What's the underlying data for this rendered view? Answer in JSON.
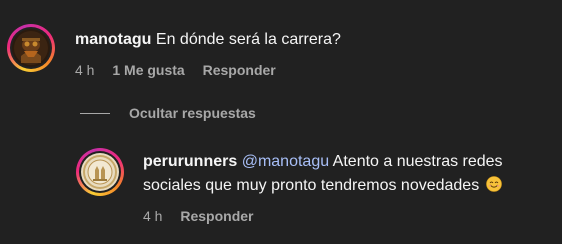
{
  "comment": {
    "username": "manotagu",
    "text": "En dónde será la carrera?",
    "time": "4 h",
    "likes": "1 Me gusta",
    "reply_label": "Responder"
  },
  "replies_toggle": {
    "label": "Ocultar respuestas"
  },
  "reply": {
    "username": "perurunners",
    "mention": "@manotagu",
    "text_line1": "Atento a nuestras redes",
    "text_line2": "sociales que muy pronto tendremos novedades",
    "emoji": "smiling-face-icon",
    "time": "4 h",
    "reply_label": "Responder"
  },
  "colors": {
    "background": "#212121",
    "text": "#f5f5f5",
    "secondary": "#a8a8a8",
    "mention": "#a8bff7"
  }
}
